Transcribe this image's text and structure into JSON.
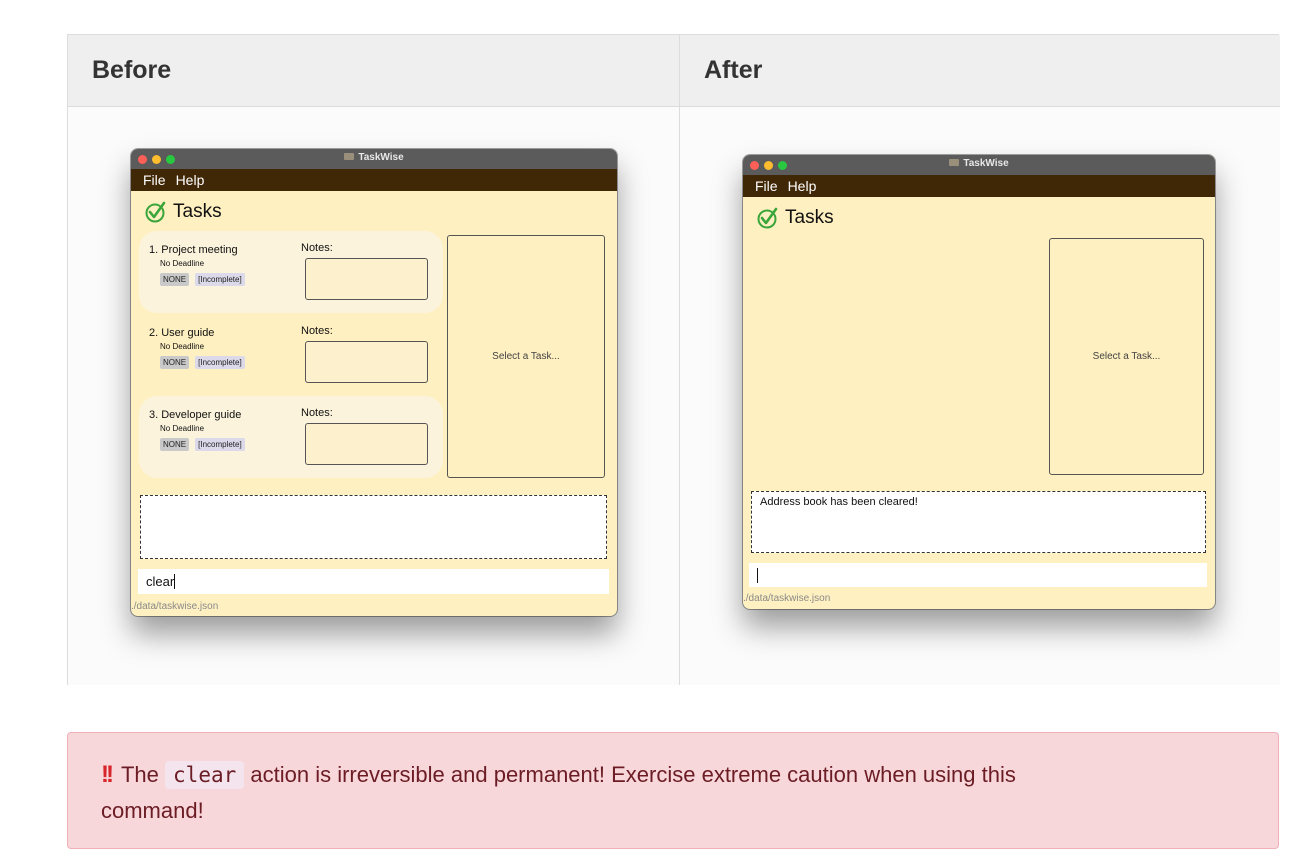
{
  "table": {
    "before_header": "Before",
    "after_header": "After"
  },
  "app": {
    "window_title": "TaskWise",
    "menu": [
      "File",
      "Help"
    ],
    "tasks_heading": "Tasks",
    "notes_label": "Notes:",
    "detail_placeholder": "Select a Task...",
    "status_path": "./data/taskwise.json"
  },
  "before": {
    "tasks": [
      {
        "name": "1. Project meeting",
        "deadline": "No Deadline",
        "priority": "NONE",
        "status": "[Incomplete]"
      },
      {
        "name": "2. User guide",
        "deadline": "No Deadline",
        "priority": "NONE",
        "status": "[Incomplete]"
      },
      {
        "name": "3. Developer guide",
        "deadline": "No Deadline",
        "priority": "NONE",
        "status": "[Incomplete]"
      }
    ],
    "result_text": "",
    "command_text": "clear"
  },
  "after": {
    "result_text": "Address book has been cleared!",
    "command_text": ""
  },
  "alert": {
    "prefix": "The",
    "code": "clear",
    "line1_rest": "action is irreversible and permanent! Exercise extreme caution when using this",
    "line2": "command!"
  },
  "colors": {
    "window_bg": "#fef0c0",
    "menubar_bg": "#402706",
    "check_green": "#3aa53a",
    "alert_bg": "#f8d7da",
    "alert_text": "#6b1c24"
  }
}
